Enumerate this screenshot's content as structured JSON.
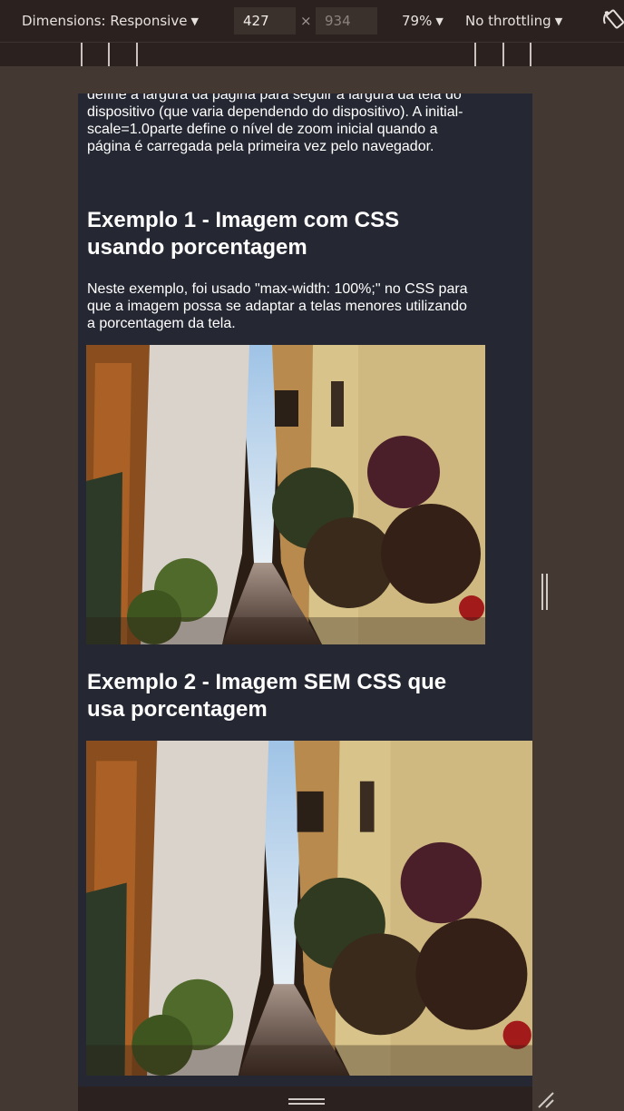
{
  "toolbar": {
    "dimensions_label": "Dimensions: Responsive",
    "width_value": "427",
    "times_symbol": "×",
    "height_value": "934",
    "zoom": "79%",
    "throttling": "No throttling",
    "dropdown_icon": "caret-down-icon",
    "rotate_icon": "rotate-icon"
  },
  "page": {
    "intro_text": "define a largura da página para seguir a largura da tela do dispositivo (que varia dependendo do dispositivo). A initial-scale=1.0parte define o nível de zoom inicial quando a página é carregada pela primeira vez pelo navegador.",
    "example1_heading": "Exemplo 1 - Imagem com CSS usando porcentagem",
    "example1_text": "Neste exemplo, foi usado \"max-width: 100%;\" no CSS para que a imagem possa se adaptar a telas menores utilizando a porcentagem da tela.",
    "example2_heading": "Exemplo 2 - Imagem SEM CSS que usa porcentagem"
  },
  "colors": {
    "toolbar_bg": "#2b2220",
    "outer_bg": "#433832",
    "page_bg": "#252833",
    "text": "#ffffff"
  }
}
